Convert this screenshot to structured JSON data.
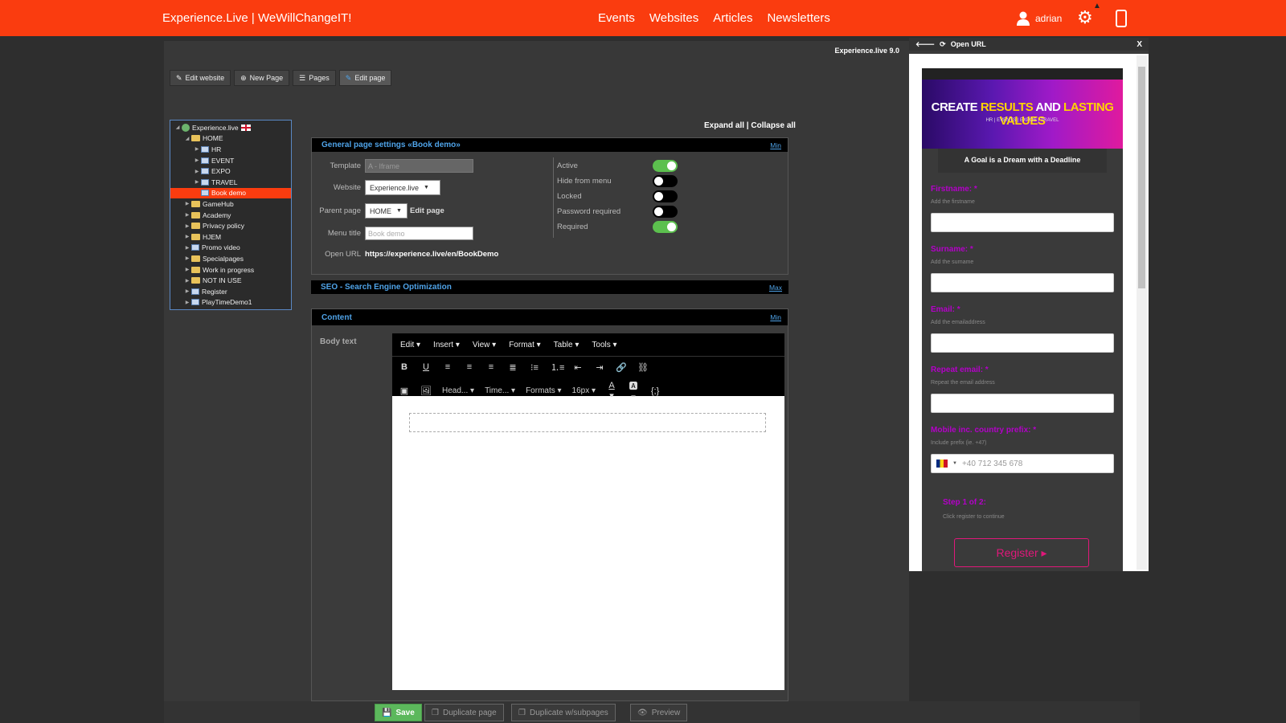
{
  "topbar": {
    "brand": "Experience.Live | WeWillChangeIT!",
    "nav": [
      "Events",
      "Websites",
      "Articles",
      "Newsletters"
    ],
    "username": "adrian",
    "warning_glyph": "▲",
    "colors": {
      "bar": "#fa3c0f"
    }
  },
  "main": {
    "version": "Experience.live 9.0",
    "toolbar": {
      "edit_website": "Edit website",
      "new_page": "New Page",
      "pages": "Pages",
      "edit_page": "Edit page"
    },
    "tree": [
      {
        "label": "Experience.live",
        "type": "root",
        "level": 0
      },
      {
        "label": "HOME",
        "type": "folder",
        "level": 1
      },
      {
        "label": "HR",
        "type": "page",
        "level": 2
      },
      {
        "label": "EVENT",
        "type": "page",
        "level": 2
      },
      {
        "label": "EXPO",
        "type": "page",
        "level": 2
      },
      {
        "label": "TRAVEL",
        "type": "page",
        "level": 2
      },
      {
        "label": "Book demo",
        "type": "page",
        "level": 2,
        "selected": true
      },
      {
        "label": "GameHub",
        "type": "folder",
        "level": 1
      },
      {
        "label": "Academy",
        "type": "folder",
        "level": 1
      },
      {
        "label": "Privacy policy",
        "type": "folder",
        "level": 1
      },
      {
        "label": "HJEM",
        "type": "folder",
        "level": 1
      },
      {
        "label": "Promo video",
        "type": "page",
        "level": 1
      },
      {
        "label": "Specialpages",
        "type": "folder",
        "level": 1
      },
      {
        "label": "Work in progress",
        "type": "folder",
        "level": 1
      },
      {
        "label": "NOT IN USE",
        "type": "folder",
        "level": 1
      },
      {
        "label": "Register",
        "type": "page",
        "level": 1
      },
      {
        "label": "PlayTimeDemo1",
        "type": "page",
        "level": 1
      }
    ],
    "expand_all": "Expand all",
    "collapse_all": "Collapse all"
  },
  "general": {
    "title": "General page settings «Book demo»",
    "min": "Min",
    "template_label": "Template",
    "template_value": "A - Iframe",
    "website_label": "Website",
    "website_value": "Experience.live",
    "parent_label": "Parent page",
    "parent_value": "HOME",
    "edit_page_link": "Edit page",
    "menu_title_label": "Menu title",
    "menu_title_placeholder": "Book demo",
    "open_url_label": "Open URL",
    "open_url_value": "https://experience.live/en/BookDemo",
    "toggles": [
      {
        "label": "Active",
        "on": true
      },
      {
        "label": "Hide from menu",
        "on": false
      },
      {
        "label": "Locked",
        "on": false
      },
      {
        "label": "Password required",
        "on": false
      },
      {
        "label": "Required",
        "on": true
      }
    ]
  },
  "seo": {
    "title": "SEO - Search Engine Optimization",
    "max": "Max"
  },
  "content": {
    "title": "Content",
    "min": "Min",
    "body_label": "Body text",
    "menu": [
      "Edit",
      "Insert",
      "View",
      "Format",
      "Table",
      "Tools"
    ],
    "heading_dd": "Head...",
    "font_dd": "Time...",
    "formats_dd": "Formats",
    "size_dd": "16px"
  },
  "bottom": {
    "save": "Save",
    "duplicate_page": "Duplicate page",
    "duplicate_sub": "Duplicate w/subpages",
    "preview": "Preview"
  },
  "side": {
    "title": "Open URL",
    "close": "X",
    "banner_a": "CREATE ",
    "banner_b": "RESULTS",
    "banner_c": " AND ",
    "banner_d": "LASTING VALUES",
    "banner_sub": "HR | EVENTS | EXPOS | TRAVEL",
    "tagline": "A Goal is a Dream with a Deadline",
    "fields": [
      {
        "label": "Firstname: *",
        "help": "Add the firstname"
      },
      {
        "label": "Surname: *",
        "help": "Add the surname"
      },
      {
        "label": "Email: *",
        "help": "Add the emailaddress"
      },
      {
        "label": "Repeat email: *",
        "help": "Repeat the email address"
      }
    ],
    "mobile_label": "Mobile inc. country prefix: *",
    "mobile_help": "Include prefix (ie. +47)",
    "mobile_placeholder": "+40 712 345 678",
    "step": "Step 1 of 2:",
    "step_help": "Click register to continue",
    "register": "Register ▸"
  }
}
